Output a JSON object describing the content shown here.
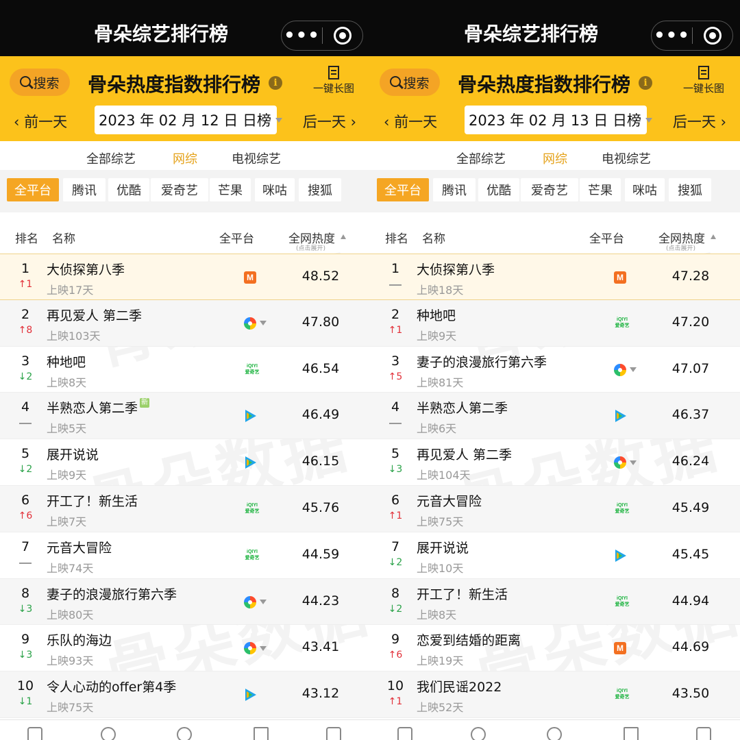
{
  "panels": [
    {
      "app_title": "骨朵综艺排行榜",
      "search_label": "搜索",
      "header_title": "骨朵热度指数排行榜",
      "long_image_label": "一键长图",
      "prev_day": "前一天",
      "next_day": "后一天",
      "date": "2023 年 02 月 12 日  日榜",
      "category_tabs": [
        "全部综艺",
        "网综",
        "电视综艺"
      ],
      "active_category": 1,
      "platforms": [
        "全平台",
        "腾讯",
        "优酷",
        "爱奇艺",
        "芒果",
        "咪咕",
        "搜狐"
      ],
      "active_platform": 0,
      "columns": {
        "rank": "排名",
        "name": "名称",
        "platform": "全平台",
        "heat": "全网热度",
        "heat_sub": "(点击展开)"
      },
      "watermark": "骨朵数据",
      "rows": [
        {
          "rank": "1",
          "delta": "1",
          "dir": "up",
          "name": "大侦探第八季",
          "days": "上映17天",
          "platform": "mango",
          "heat": "48.52",
          "is_new": false
        },
        {
          "rank": "2",
          "delta": "8",
          "dir": "up",
          "name": "再见爱人 第二季",
          "days": "上映103天",
          "platform": "youku",
          "heat": "47.80",
          "is_new": false
        },
        {
          "rank": "3",
          "delta": "2",
          "dir": "down",
          "name": "种地吧",
          "days": "上映8天",
          "platform": "iqiyi",
          "heat": "46.54",
          "is_new": false
        },
        {
          "rank": "4",
          "delta": "",
          "dir": "same",
          "name": "半熟恋人第二季",
          "days": "上映5天",
          "platform": "tencent",
          "heat": "46.49",
          "is_new": true,
          "new_label": "新"
        },
        {
          "rank": "5",
          "delta": "2",
          "dir": "down",
          "name": "展开说说",
          "days": "上映9天",
          "platform": "tencent",
          "heat": "46.15",
          "is_new": false
        },
        {
          "rank": "6",
          "delta": "6",
          "dir": "up",
          "name": "开工了！新生活",
          "days": "上映7天",
          "platform": "iqiyi",
          "heat": "45.76",
          "is_new": false
        },
        {
          "rank": "7",
          "delta": "",
          "dir": "same",
          "name": "元音大冒险",
          "days": "上映74天",
          "platform": "iqiyi",
          "heat": "44.59",
          "is_new": false
        },
        {
          "rank": "8",
          "delta": "3",
          "dir": "down",
          "name": "妻子的浪漫旅行第六季",
          "days": "上映80天",
          "platform": "youku",
          "heat": "44.23",
          "is_new": false
        },
        {
          "rank": "9",
          "delta": "3",
          "dir": "down",
          "name": "乐队的海边",
          "days": "上映93天",
          "platform": "youku",
          "heat": "43.41",
          "is_new": false
        },
        {
          "rank": "10",
          "delta": "1",
          "dir": "down",
          "name": "令人心动的offer第4季",
          "days": "上映75天",
          "platform": "tencent",
          "heat": "43.12",
          "is_new": false
        }
      ]
    },
    {
      "app_title": "骨朵综艺排行榜",
      "search_label": "搜索",
      "header_title": "骨朵热度指数排行榜",
      "long_image_label": "一键长图",
      "prev_day": "前一天",
      "next_day": "后一天",
      "date": "2023 年 02 月 13 日  日榜",
      "category_tabs": [
        "全部综艺",
        "网综",
        "电视综艺"
      ],
      "active_category": 1,
      "platforms": [
        "全平台",
        "腾讯",
        "优酷",
        "爱奇艺",
        "芒果",
        "咪咕",
        "搜狐"
      ],
      "active_platform": 0,
      "columns": {
        "rank": "排名",
        "name": "名称",
        "platform": "全平台",
        "heat": "全网热度",
        "heat_sub": "(点击展开)"
      },
      "watermark": "骨朵数据",
      "rows": [
        {
          "rank": "1",
          "delta": "",
          "dir": "same",
          "name": "大侦探第八季",
          "days": "上映18天",
          "platform": "mango",
          "heat": "47.28",
          "is_new": false
        },
        {
          "rank": "2",
          "delta": "1",
          "dir": "up",
          "name": "种地吧",
          "days": "上映9天",
          "platform": "iqiyi",
          "heat": "47.20",
          "is_new": false
        },
        {
          "rank": "3",
          "delta": "5",
          "dir": "up",
          "name": "妻子的浪漫旅行第六季",
          "days": "上映81天",
          "platform": "youku",
          "heat": "47.07",
          "is_new": false
        },
        {
          "rank": "4",
          "delta": "",
          "dir": "same",
          "name": "半熟恋人第二季",
          "days": "上映6天",
          "platform": "tencent",
          "heat": "46.37",
          "is_new": false
        },
        {
          "rank": "5",
          "delta": "3",
          "dir": "down",
          "name": "再见爱人 第二季",
          "days": "上映104天",
          "platform": "youku",
          "heat": "46.24",
          "is_new": false
        },
        {
          "rank": "6",
          "delta": "1",
          "dir": "up",
          "name": "元音大冒险",
          "days": "上映75天",
          "platform": "iqiyi",
          "heat": "45.49",
          "is_new": false
        },
        {
          "rank": "7",
          "delta": "2",
          "dir": "down",
          "name": "展开说说",
          "days": "上映10天",
          "platform": "tencent",
          "heat": "45.45",
          "is_new": false
        },
        {
          "rank": "8",
          "delta": "2",
          "dir": "down",
          "name": "开工了！新生活",
          "days": "上映8天",
          "platform": "iqiyi",
          "heat": "44.94",
          "is_new": false
        },
        {
          "rank": "9",
          "delta": "6",
          "dir": "up",
          "name": "恋爱到结婚的距离",
          "days": "上映19天",
          "platform": "mango",
          "heat": "44.69",
          "is_new": false
        },
        {
          "rank": "10",
          "delta": "1",
          "dir": "up",
          "name": "我们民谣2022",
          "days": "上映52天",
          "platform": "iqiyi",
          "heat": "43.50",
          "is_new": false
        }
      ]
    }
  ],
  "logos": {
    "mango_glyph": "M",
    "iqiyi_text": "iQIYI\n爱奇艺",
    "more_dots": "•••",
    "info_glyph": "i",
    "prev_arrow": "‹",
    "next_arrow": "›"
  },
  "colors": {
    "header_yellow": "#fcc21b",
    "accent_orange": "#f5a623",
    "up_red": "#e2313a",
    "down_green": "#2aa248"
  }
}
